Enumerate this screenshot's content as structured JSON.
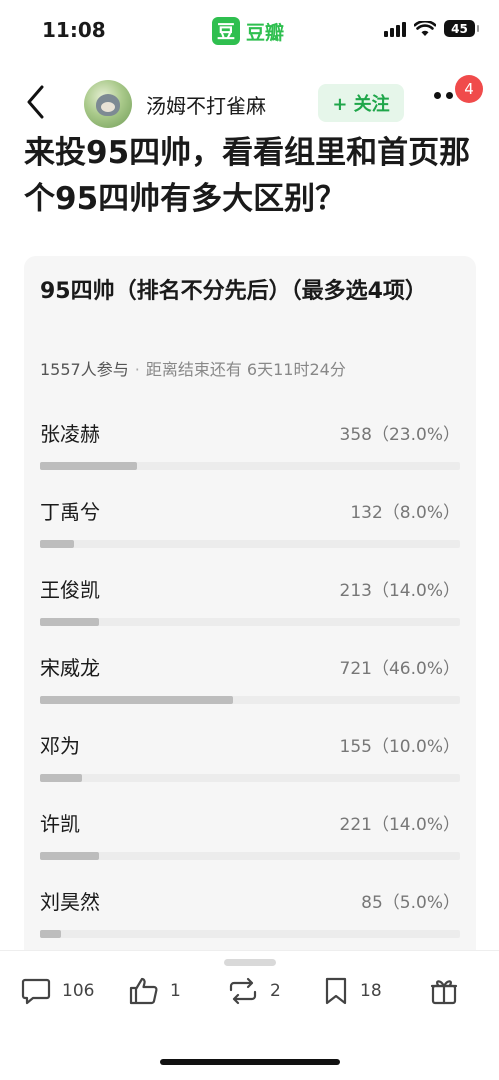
{
  "status": {
    "time": "11:08",
    "battery": "45"
  },
  "app": {
    "logo": "豆",
    "name": "豆瓣"
  },
  "nav": {
    "author": "汤姆不打雀麻",
    "follow_label": "+ 关注",
    "notification_count": "4"
  },
  "post": {
    "title": "来投95四帅，看看组里和首页那个95四帅有多大区别？"
  },
  "poll": {
    "title": "95四帅（排名不分先后）（最多选4项）",
    "participants": "1557人参与",
    "remaining": "距离结束还有 6天11时24分",
    "options": [
      {
        "name": "张凌赫",
        "result": "358（23.0%）",
        "percent": 23.0
      },
      {
        "name": "丁禹兮",
        "result": "132（8.0%）",
        "percent": 8.0
      },
      {
        "name": "王俊凯",
        "result": "213（14.0%）",
        "percent": 14.0
      },
      {
        "name": "宋威龙",
        "result": "721（46.0%）",
        "percent": 46.0
      },
      {
        "name": "邓为",
        "result": "155（10.0%）",
        "percent": 10.0
      },
      {
        "name": "许凯",
        "result": "221（14.0%）",
        "percent": 14.0
      },
      {
        "name": "刘昊然",
        "result": "85（5.0%）",
        "percent": 5.0
      }
    ]
  },
  "toolbar": {
    "comments": "106",
    "likes": "1",
    "reshares": "2",
    "collects": "18"
  },
  "colors": {
    "brand_green": "#2fbf4f",
    "badge_red": "#f04b4b",
    "bar_fill": "#bdbdbd"
  },
  "icons": [
    "back-chevron-icon",
    "more-icon",
    "comment-icon",
    "like-icon",
    "reshare-icon",
    "bookmark-icon",
    "gift-icon"
  ]
}
